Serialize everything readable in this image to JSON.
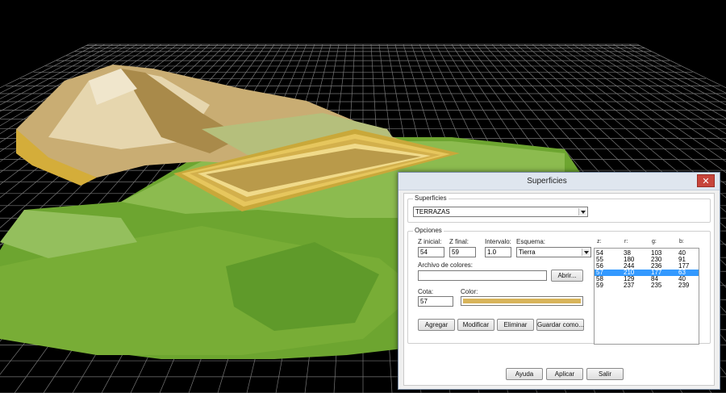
{
  "dialog": {
    "title": "Superficies",
    "close_label": "✕",
    "superficies_group": {
      "legend": "Superficies",
      "selected": "TERRAZAS"
    },
    "opciones_group": {
      "legend": "Opciones",
      "z_inicial": {
        "label": "Z inicial:",
        "value": "54"
      },
      "z_final": {
        "label": "Z final:",
        "value": "59"
      },
      "intervalo": {
        "label": "Intervalo:",
        "value": "1.0"
      },
      "esquema": {
        "label": "Esquema:",
        "value": "Tierra"
      },
      "archivo": {
        "label": "Archivo de colores:",
        "value": ""
      },
      "abrir_label": "Abrir...",
      "cota": {
        "label": "Cota:",
        "value": "57"
      },
      "color_label": "Color:",
      "color_value": "#d8b45a",
      "buttons": {
        "agregar": "Agregar",
        "modificar": "Modificar",
        "eliminar": "Eliminar",
        "guardar": "Guardar como..."
      }
    },
    "table": {
      "headers": [
        "z:",
        "r:",
        "g:",
        "b:"
      ],
      "rows": [
        [
          "54",
          "38",
          "103",
          "40"
        ],
        [
          "55",
          "180",
          "230",
          "91"
        ],
        [
          "56",
          "244",
          "236",
          "177"
        ],
        [
          "57",
          "210",
          "177",
          "63"
        ],
        [
          "58",
          "129",
          "84",
          "40"
        ],
        [
          "59",
          "237",
          "235",
          "239"
        ]
      ],
      "selected_index": 3
    },
    "footer": {
      "ayuda": "Ayuda",
      "aplicar": "Aplicar",
      "salir": "Salir"
    }
  },
  "colors": {
    "grid": "#8c8c8c",
    "terrain_green": "#7fb13a",
    "terrain_tan": "#d8c08a",
    "selection": "#3399ff"
  }
}
